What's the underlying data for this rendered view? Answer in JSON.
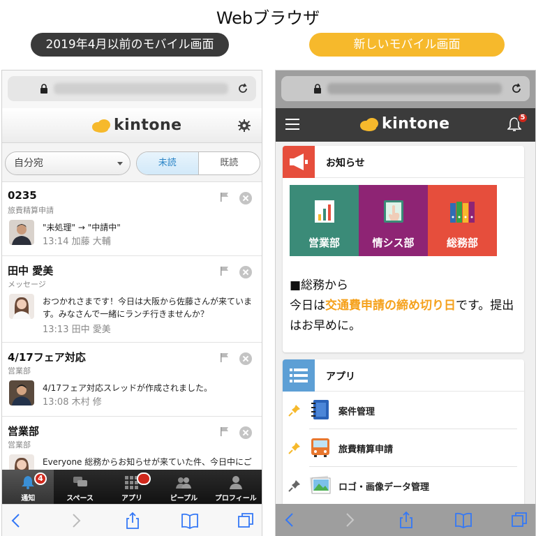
{
  "header": {
    "title": "Webブラウザ"
  },
  "labels": {
    "old": "2019年4月以前のモバイル画面",
    "new": "新しいモバイル画面"
  },
  "brand": {
    "name": "kintone",
    "accent": "#f6b92c"
  },
  "old_screen": {
    "filter": {
      "selected": "自分宛",
      "seg_unread": "未読",
      "seg_read": "既読"
    },
    "notifications": [
      {
        "title": "0235",
        "sub": "旅費精算申請",
        "message": "\"未処理\" → \"中請中\"",
        "time": "13:14",
        "user": "加藤 大輔"
      },
      {
        "title": "田中 愛美",
        "sub": "メッセージ",
        "message": "おつかれさまです！今日は大阪から佐藤さんが来ています。みなさんで一緒にランチ行きませんか？",
        "time": "13:13",
        "user": "田中 愛美"
      },
      {
        "title": "4/17フェア対応",
        "sub": "営業部",
        "message": "4/17フェア対応スレッドが作成されました。",
        "time": "13:08",
        "user": "木村 修"
      },
      {
        "title": "営業部",
        "sub": "営業部",
        "message": "Everyone 総務からお知らせが来ていた件、今日中にご対応よろしくお願いします",
        "time": "",
        "user": ""
      }
    ],
    "tabs": [
      {
        "label": "通知",
        "icon": "bell-icon",
        "badge": "4"
      },
      {
        "label": "スペース",
        "icon": "chat-icon"
      },
      {
        "label": "アプリ",
        "icon": "grid-icon"
      },
      {
        "label": "ピープル",
        "icon": "people-icon"
      },
      {
        "label": "プロフィール",
        "icon": "person-icon"
      }
    ]
  },
  "new_screen": {
    "bell_badge": "5",
    "announce": {
      "title": "お知らせ",
      "tiles": [
        {
          "label": "営業部",
          "color": "#3b8b78"
        },
        {
          "label": "情シス部",
          "color": "#8e2474"
        },
        {
          "label": "総務部",
          "color": "#e64e3c"
        }
      ],
      "line1": "■総務から",
      "line2_pre": "今日は",
      "line2_hl": "交通費申請の締め切り日",
      "line2_post": "です。提出はお早めに。"
    },
    "apps": {
      "title": "アプリ",
      "items": [
        {
          "label": "案件管理",
          "icon": "notebook-icon"
        },
        {
          "label": "旅費精算申請",
          "icon": "bus-icon"
        },
        {
          "label": "ロゴ・画像データ管理",
          "icon": "image-icon"
        }
      ]
    }
  }
}
